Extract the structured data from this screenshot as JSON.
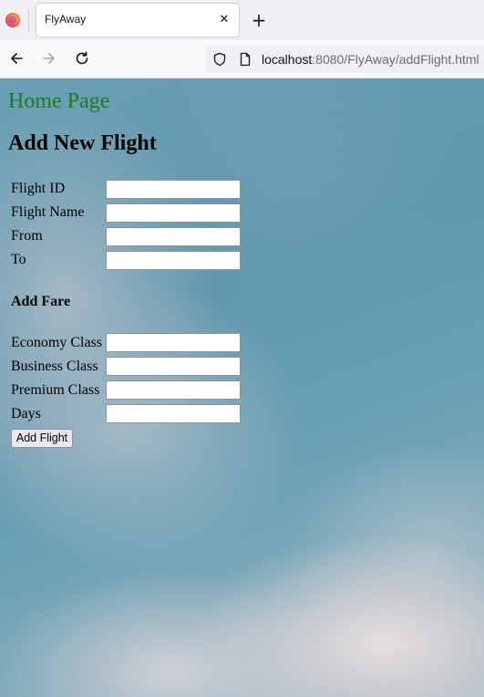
{
  "browser": {
    "tab_title": "FlyAway",
    "tab_close_glyph": "✕",
    "new_tab_glyph": "+",
    "url_host": "localhost",
    "url_rest": ":8080/FlyAway/addFlight.html",
    "icons": [
      "firefox-logo",
      "close-icon",
      "plus-icon",
      "back-arrow-icon",
      "forward-arrow-icon",
      "reload-icon",
      "shield-icon",
      "page-icon"
    ]
  },
  "page": {
    "home_link": "Home Page",
    "title": "Add New Flight",
    "flight_fields": [
      {
        "label": "Flight ID",
        "value": ""
      },
      {
        "label": "Flight Name",
        "value": ""
      },
      {
        "label": "From",
        "value": ""
      },
      {
        "label": "To",
        "value": ""
      }
    ],
    "fare_heading": "Add Fare",
    "fare_fields": [
      {
        "label": "Economy Class",
        "value": ""
      },
      {
        "label": "Business Class",
        "value": ""
      },
      {
        "label": "Premium Class",
        "value": ""
      },
      {
        "label": "Days",
        "value": ""
      }
    ],
    "submit_label": "Add Flight"
  },
  "colors": {
    "home_link": "#1c7d1c",
    "sky": "#6a9fb4"
  }
}
